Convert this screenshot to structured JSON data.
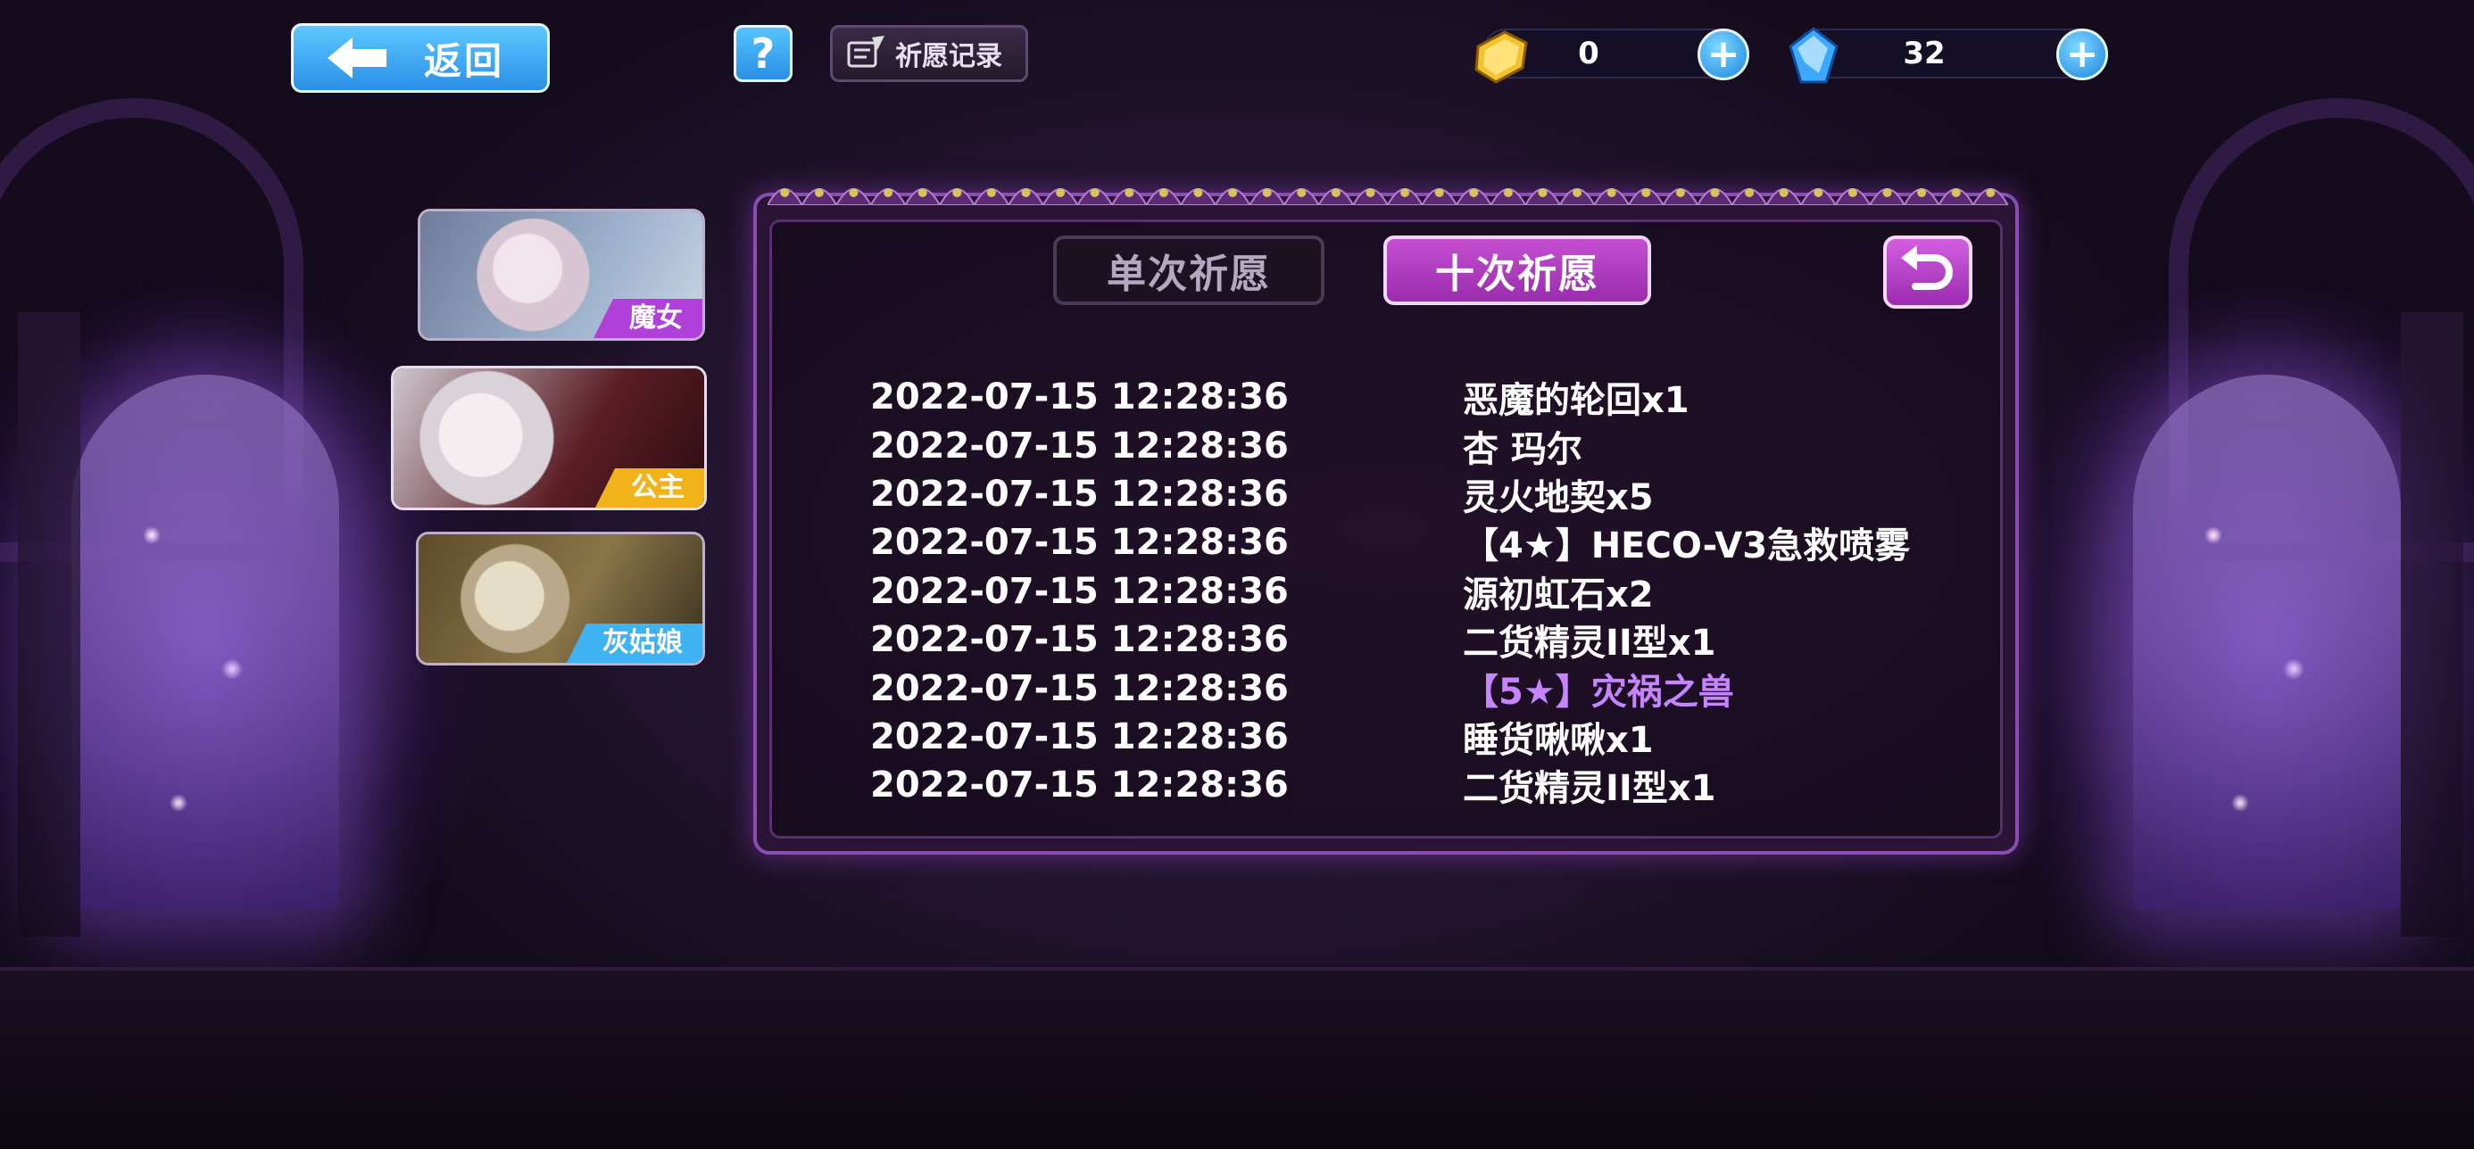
{
  "top_bar": {
    "back_label": "返回",
    "help_label": "?",
    "record_label": "祈愿记录",
    "gold_value": "0",
    "gem_value": "32",
    "plus_label": "+"
  },
  "banners": [
    {
      "tag": "魔女",
      "tag_color": "#b13fd9"
    },
    {
      "tag": "公主",
      "tag_color": "#f2b21a"
    },
    {
      "tag": "灰姑娘",
      "tag_color": "#3fb3f2"
    }
  ],
  "panel": {
    "tab_single": "单次祈愿",
    "tab_ten": "十次祈愿",
    "active_tab": "十次祈愿",
    "records": [
      {
        "time": "2022-07-15 12:28:36",
        "item": "恶魔的轮回x1",
        "rare": false
      },
      {
        "time": "2022-07-15 12:28:36",
        "item": "杏 玛尔",
        "rare": false
      },
      {
        "time": "2022-07-15 12:28:36",
        "item": "灵火地契x5",
        "rare": false
      },
      {
        "time": "2022-07-15 12:28:36",
        "item": "【4★】HECO-V3急救喷雾",
        "rare": false
      },
      {
        "time": "2022-07-15 12:28:36",
        "item": "源初虹石x2",
        "rare": false
      },
      {
        "time": "2022-07-15 12:28:36",
        "item": "二货精灵II型x1",
        "rare": false
      },
      {
        "time": "2022-07-15 12:28:36",
        "item": "【5★】灾祸之兽",
        "rare": true
      },
      {
        "time": "2022-07-15 12:28:36",
        "item": "睡货啾啾x1",
        "rare": false
      },
      {
        "time": "2022-07-15 12:28:36",
        "item": "二货精灵II型x1",
        "rare": false
      }
    ]
  },
  "colors": {
    "rare_item": "#c684ff",
    "accent_blue": "#2a8fe8",
    "accent_purple": "#b13fd0"
  },
  "icons": [
    "arrow-left-icon",
    "question-icon",
    "quill-scroll-icon",
    "gold-icon",
    "gem-icon",
    "plus-icon",
    "return-icon"
  ]
}
